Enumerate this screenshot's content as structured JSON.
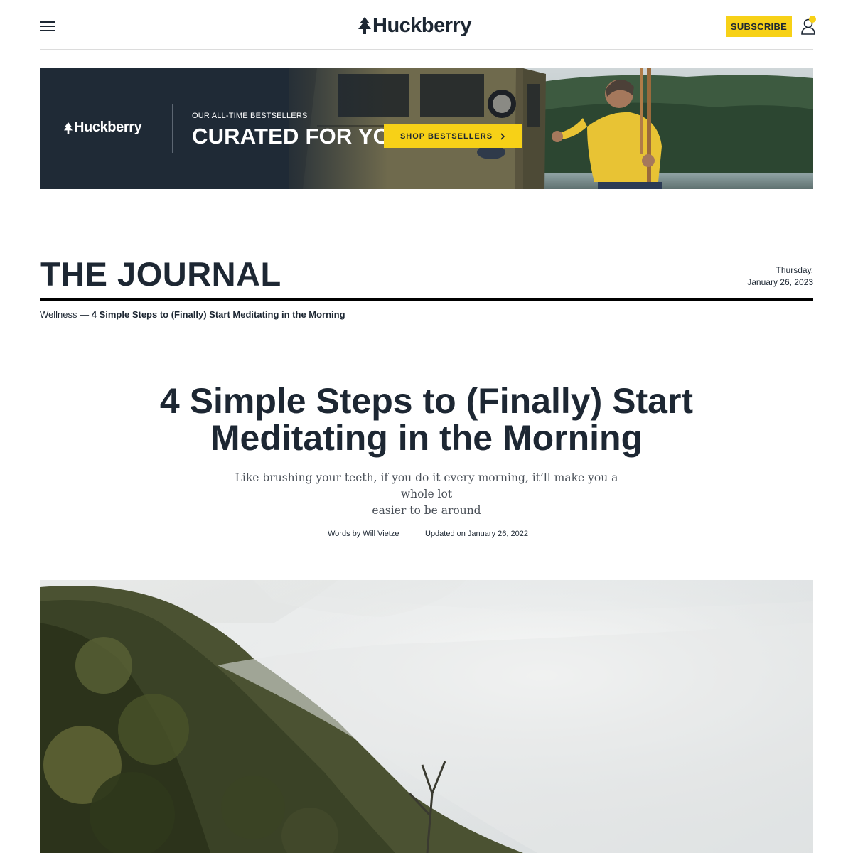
{
  "header": {
    "logo_text": "Huckberry",
    "subscribe_label": "SUBSCRIBE"
  },
  "banner": {
    "logo_text": "Huckberry",
    "eyebrow": "OUR ALL-TIME BESTSELLERS",
    "title": "CURATED FOR YOU",
    "cta_label": "SHOP BESTSELLERS"
  },
  "journal": {
    "title": "THE JOURNAL",
    "date_day": "Thursday,",
    "date_full": "January 26, 2023"
  },
  "breadcrumb": {
    "category": "Wellness",
    "separator": " — ",
    "current": "4 Simple Steps to (Finally) Start Meditating in the Morning"
  },
  "article": {
    "title_line1": "4 Simple Steps to (Finally) Start",
    "title_line2": "Meditating in the Morning",
    "dek_line1": "Like brushing your teeth, if you do it every morning, it’ll make you a whole lot",
    "dek_line2": "easier to be around",
    "byline": "Words by Will Vietze",
    "updated": "Updated on January 26, 2022"
  },
  "colors": {
    "accent_yellow": "#f7d117",
    "navy": "#1d2733",
    "banner_bg": "#1f2a36"
  },
  "icons": {
    "menu": "hamburger-menu-icon",
    "account": "user-icon",
    "logo_mark": "pine-tree-icon",
    "cta_arrow": "chevron-right-icon"
  }
}
